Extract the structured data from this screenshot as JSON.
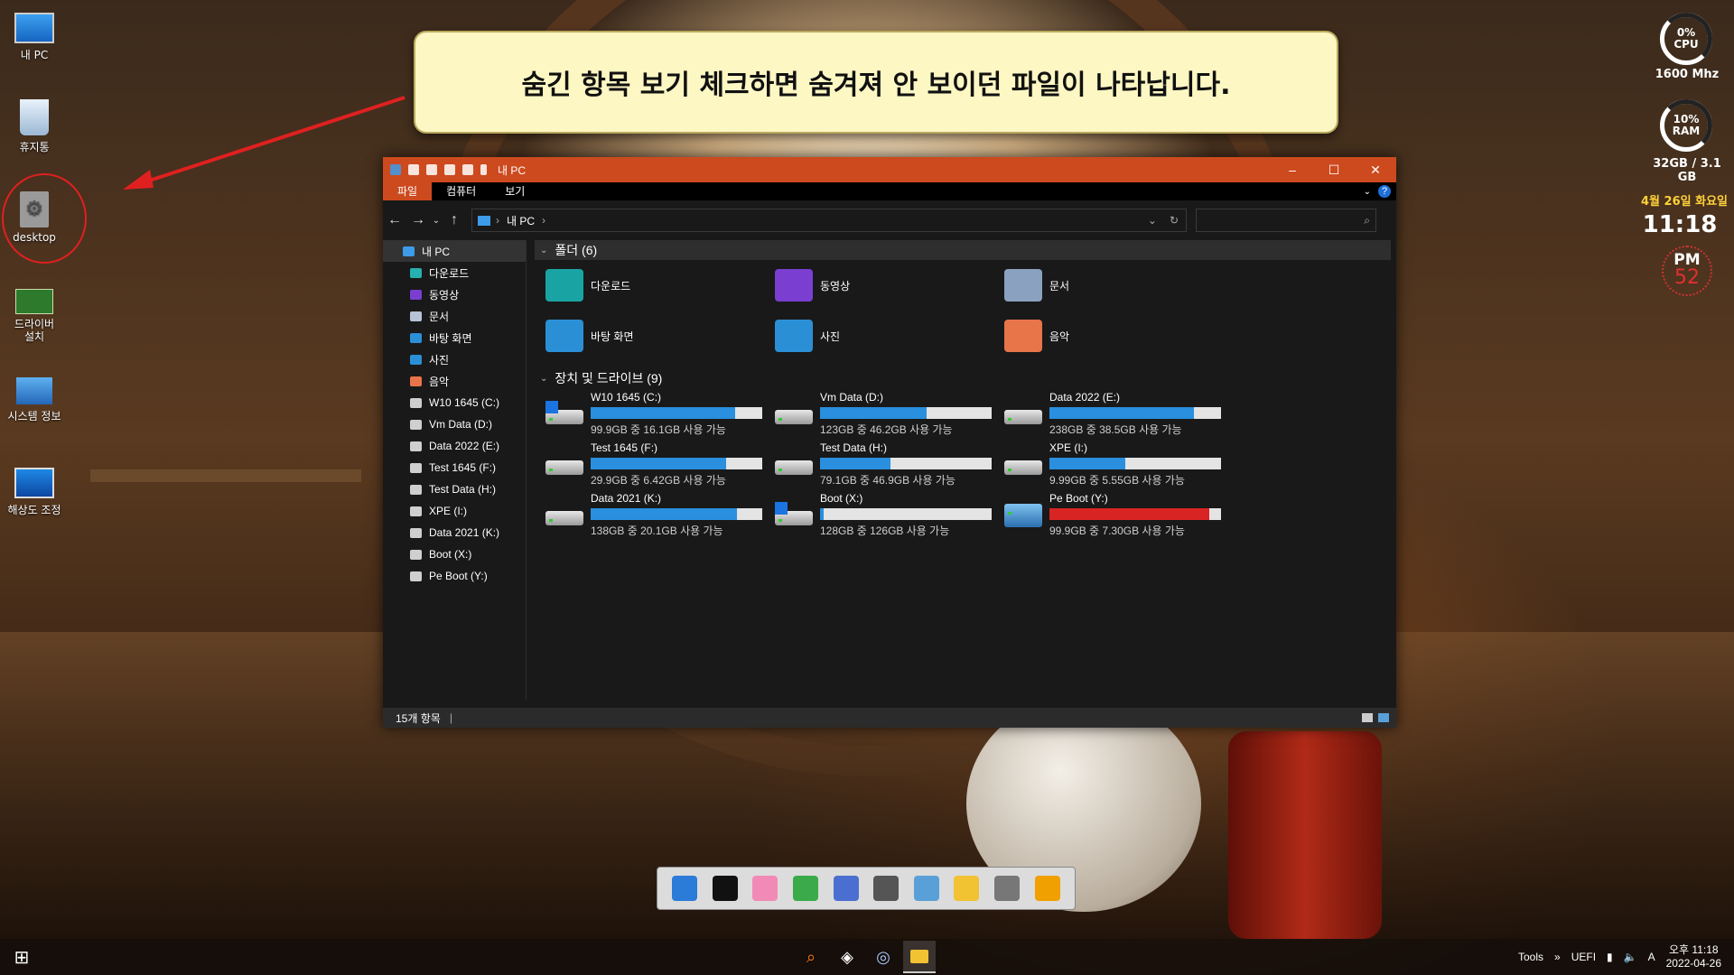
{
  "desktop": {
    "icons": [
      {
        "label": "내 PC",
        "icon": "monitor-icon"
      },
      {
        "label": "휴지통",
        "icon": "recycle-bin-icon"
      },
      {
        "label": "desktop",
        "icon": "settings-file-icon"
      },
      {
        "label": "드라이버\n설치",
        "icon": "pci-card-icon"
      },
      {
        "label": "시스템 정보",
        "icon": "system-info-icon"
      },
      {
        "label": "해상도 조정",
        "icon": "display-icon"
      }
    ]
  },
  "callout": {
    "text": "숨긴 항목 보기 체크하면 숨겨져 안 보이던 파일이 나타납니다."
  },
  "widgets": {
    "cpu": {
      "percent_label": "0%",
      "name": "CPU",
      "freq": "1600 Mhz",
      "value": 0
    },
    "ram": {
      "percent_label": "10%",
      "name": "RAM",
      "usage": "32GB / 3.1 GB",
      "value": 10
    },
    "date": "4월 26일 화요일",
    "time": "11:18",
    "ampm": "PM",
    "seconds": "52"
  },
  "explorer": {
    "title": "내 PC",
    "tabs": [
      {
        "label": "파일",
        "active": true
      },
      {
        "label": "컴퓨터",
        "active": false
      },
      {
        "label": "보기",
        "active": false
      }
    ],
    "address": "내 PC",
    "search_placeholder": "",
    "nav": [
      {
        "label": "내 PC",
        "icon": "pc-icon",
        "selected": true
      },
      {
        "label": "다운로드",
        "icon": "download-icon"
      },
      {
        "label": "동영상",
        "icon": "video-icon"
      },
      {
        "label": "문서",
        "icon": "document-icon"
      },
      {
        "label": "바탕 화면",
        "icon": "desktop-icon"
      },
      {
        "label": "사진",
        "icon": "picture-icon"
      },
      {
        "label": "음악",
        "icon": "music-icon"
      },
      {
        "label": "W10 1645 (C:)",
        "icon": "drive-icon"
      },
      {
        "label": "Vm Data (D:)",
        "icon": "drive-icon"
      },
      {
        "label": "Data 2022 (E:)",
        "icon": "drive-icon"
      },
      {
        "label": "Test 1645 (F:)",
        "icon": "drive-icon"
      },
      {
        "label": "Test Data (H:)",
        "icon": "drive-icon"
      },
      {
        "label": "XPE (I:)",
        "icon": "drive-icon"
      },
      {
        "label": "Data 2021 (K:)",
        "icon": "drive-icon"
      },
      {
        "label": "Boot (X:)",
        "icon": "drive-icon"
      },
      {
        "label": "Pe Boot (Y:)",
        "icon": "drive-icon"
      }
    ],
    "folders_header": "폴더 (6)",
    "folders": [
      {
        "label": "다운로드",
        "icon": "download-folder-icon",
        "color": "#1aa3a3"
      },
      {
        "label": "동영상",
        "icon": "video-folder-icon",
        "color": "#7a3fd0"
      },
      {
        "label": "문서",
        "icon": "documents-folder-icon",
        "color": "#8aa2c0"
      },
      {
        "label": "바탕 화면",
        "icon": "desktop-folder-icon",
        "color": "#2b8fd6"
      },
      {
        "label": "사진",
        "icon": "pictures-folder-icon",
        "color": "#2b8fd6"
      },
      {
        "label": "음악",
        "icon": "music-folder-icon",
        "color": "#e8744a"
      }
    ],
    "drives_header": "장치 및 드라이브 (9)",
    "drives": [
      {
        "name": "W10 1645 (C:)",
        "free": "99.9GB 중 16.1GB 사용 가능",
        "used_fraction": 0.84,
        "icon": "windows-drive-icon",
        "warn": false
      },
      {
        "name": "Vm Data (D:)",
        "free": "123GB 중 46.2GB 사용 가능",
        "used_fraction": 0.62,
        "icon": "hdd-icon",
        "warn": false
      },
      {
        "name": "Data 2022 (E:)",
        "free": "238GB 중 38.5GB 사용 가능",
        "used_fraction": 0.84,
        "icon": "hdd-icon",
        "warn": false
      },
      {
        "name": "Test 1645 (F:)",
        "free": "29.9GB 중 6.42GB 사용 가능",
        "used_fraction": 0.79,
        "icon": "hdd-icon",
        "warn": false
      },
      {
        "name": "Test Data (H:)",
        "free": "79.1GB 중 46.9GB 사용 가능",
        "used_fraction": 0.41,
        "icon": "hdd-icon",
        "warn": false
      },
      {
        "name": "XPE (I:)",
        "free": "9.99GB 중 5.55GB 사용 가능",
        "used_fraction": 0.44,
        "icon": "hdd-icon",
        "warn": false
      },
      {
        "name": "Data 2021 (K:)",
        "free": "138GB 중 20.1GB 사용 가능",
        "used_fraction": 0.85,
        "icon": "hdd-icon",
        "warn": false
      },
      {
        "name": "Boot (X:)",
        "free": "128GB 중 126GB 사용 가능",
        "used_fraction": 0.02,
        "icon": "windows-drive-icon",
        "warn": false
      },
      {
        "name": "Pe Boot (Y:)",
        "free": "99.9GB 중 7.30GB 사용 가능",
        "used_fraction": 0.93,
        "icon": "pe-boot-drive-icon",
        "warn": true
      }
    ],
    "status": "15개 항목"
  },
  "dock": [
    {
      "icon": "cube-icon",
      "color": "#2b7bd8"
    },
    {
      "icon": "terminal-icon",
      "color": "#111111"
    },
    {
      "icon": "windows-pink-icon",
      "color": "#f28ab8"
    },
    {
      "icon": "partition-icon",
      "color": "#3aaa4a"
    },
    {
      "icon": "network-icon",
      "color": "#4a6fd0"
    },
    {
      "icon": "camera-icon",
      "color": "#555555"
    },
    {
      "icon": "notepad-icon",
      "color": "#5aa0d8"
    },
    {
      "icon": "explorer-folder-icon",
      "color": "#f1c232"
    },
    {
      "icon": "usb-icon",
      "color": "#777777"
    },
    {
      "icon": "power-icon",
      "color": "#f0a000"
    }
  ],
  "taskbar": {
    "tools_label": "Tools",
    "uefi_label": "UEFI",
    "ime_label": "A",
    "time": "오후 11:18",
    "date": "2022-04-26"
  }
}
